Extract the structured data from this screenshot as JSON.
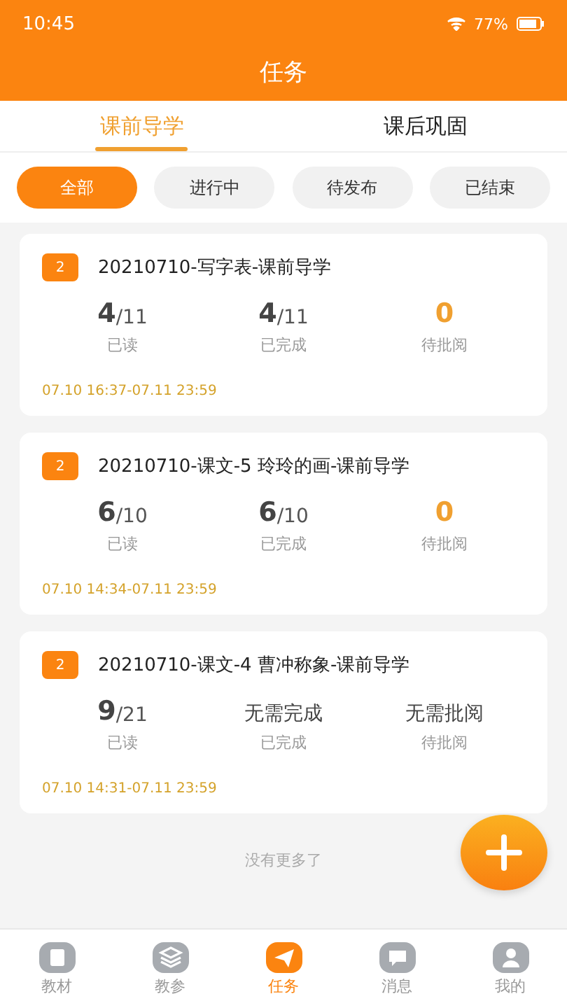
{
  "status_bar": {
    "time": "10:45",
    "battery": "77%"
  },
  "header": {
    "title": "任务"
  },
  "tabs": [
    {
      "label": "课前导学",
      "selected": true
    },
    {
      "label": "课后巩固",
      "selected": false
    }
  ],
  "filters": [
    {
      "label": "全部",
      "selected": true
    },
    {
      "label": "进行中",
      "selected": false
    },
    {
      "label": "待发布",
      "selected": false
    },
    {
      "label": "已结束",
      "selected": false
    }
  ],
  "tasks": [
    {
      "badge": "2",
      "title": "20210710-写字表-课前导学",
      "stats": [
        {
          "kind": "fraction",
          "value": "4",
          "total": "/11",
          "label": "已读"
        },
        {
          "kind": "fraction",
          "value": "4",
          "total": "/11",
          "label": "已完成"
        },
        {
          "kind": "count",
          "value": "0",
          "label": "待批阅"
        }
      ],
      "time": "07.10  16:37-07.11  23:59"
    },
    {
      "badge": "2",
      "title": "20210710-课文-5  玲玲的画-课前导学",
      "stats": [
        {
          "kind": "fraction",
          "value": "6",
          "total": "/10",
          "label": "已读"
        },
        {
          "kind": "fraction",
          "value": "6",
          "total": "/10",
          "label": "已完成"
        },
        {
          "kind": "count",
          "value": "0",
          "label": "待批阅"
        }
      ],
      "time": "07.10  14:34-07.11  23:59"
    },
    {
      "badge": "2",
      "title": "20210710-课文-4  曹冲称象-课前导学",
      "stats": [
        {
          "kind": "fraction",
          "value": "9",
          "total": "/21",
          "label": "已读"
        },
        {
          "kind": "text",
          "value": "无需完成",
          "label": "已完成"
        },
        {
          "kind": "text",
          "value": "无需批阅",
          "label": "待批阅"
        }
      ],
      "time": "07.10  14:31-07.11  23:59"
    }
  ],
  "end_note": "没有更多了",
  "nav": [
    {
      "kind": "book",
      "label": "教材",
      "selected": false
    },
    {
      "kind": "layers",
      "label": "教参",
      "selected": false
    },
    {
      "kind": "plane",
      "label": "任务",
      "selected": true
    },
    {
      "kind": "chat",
      "label": "消息",
      "selected": false
    },
    {
      "kind": "person",
      "label": "我的",
      "selected": false
    }
  ]
}
